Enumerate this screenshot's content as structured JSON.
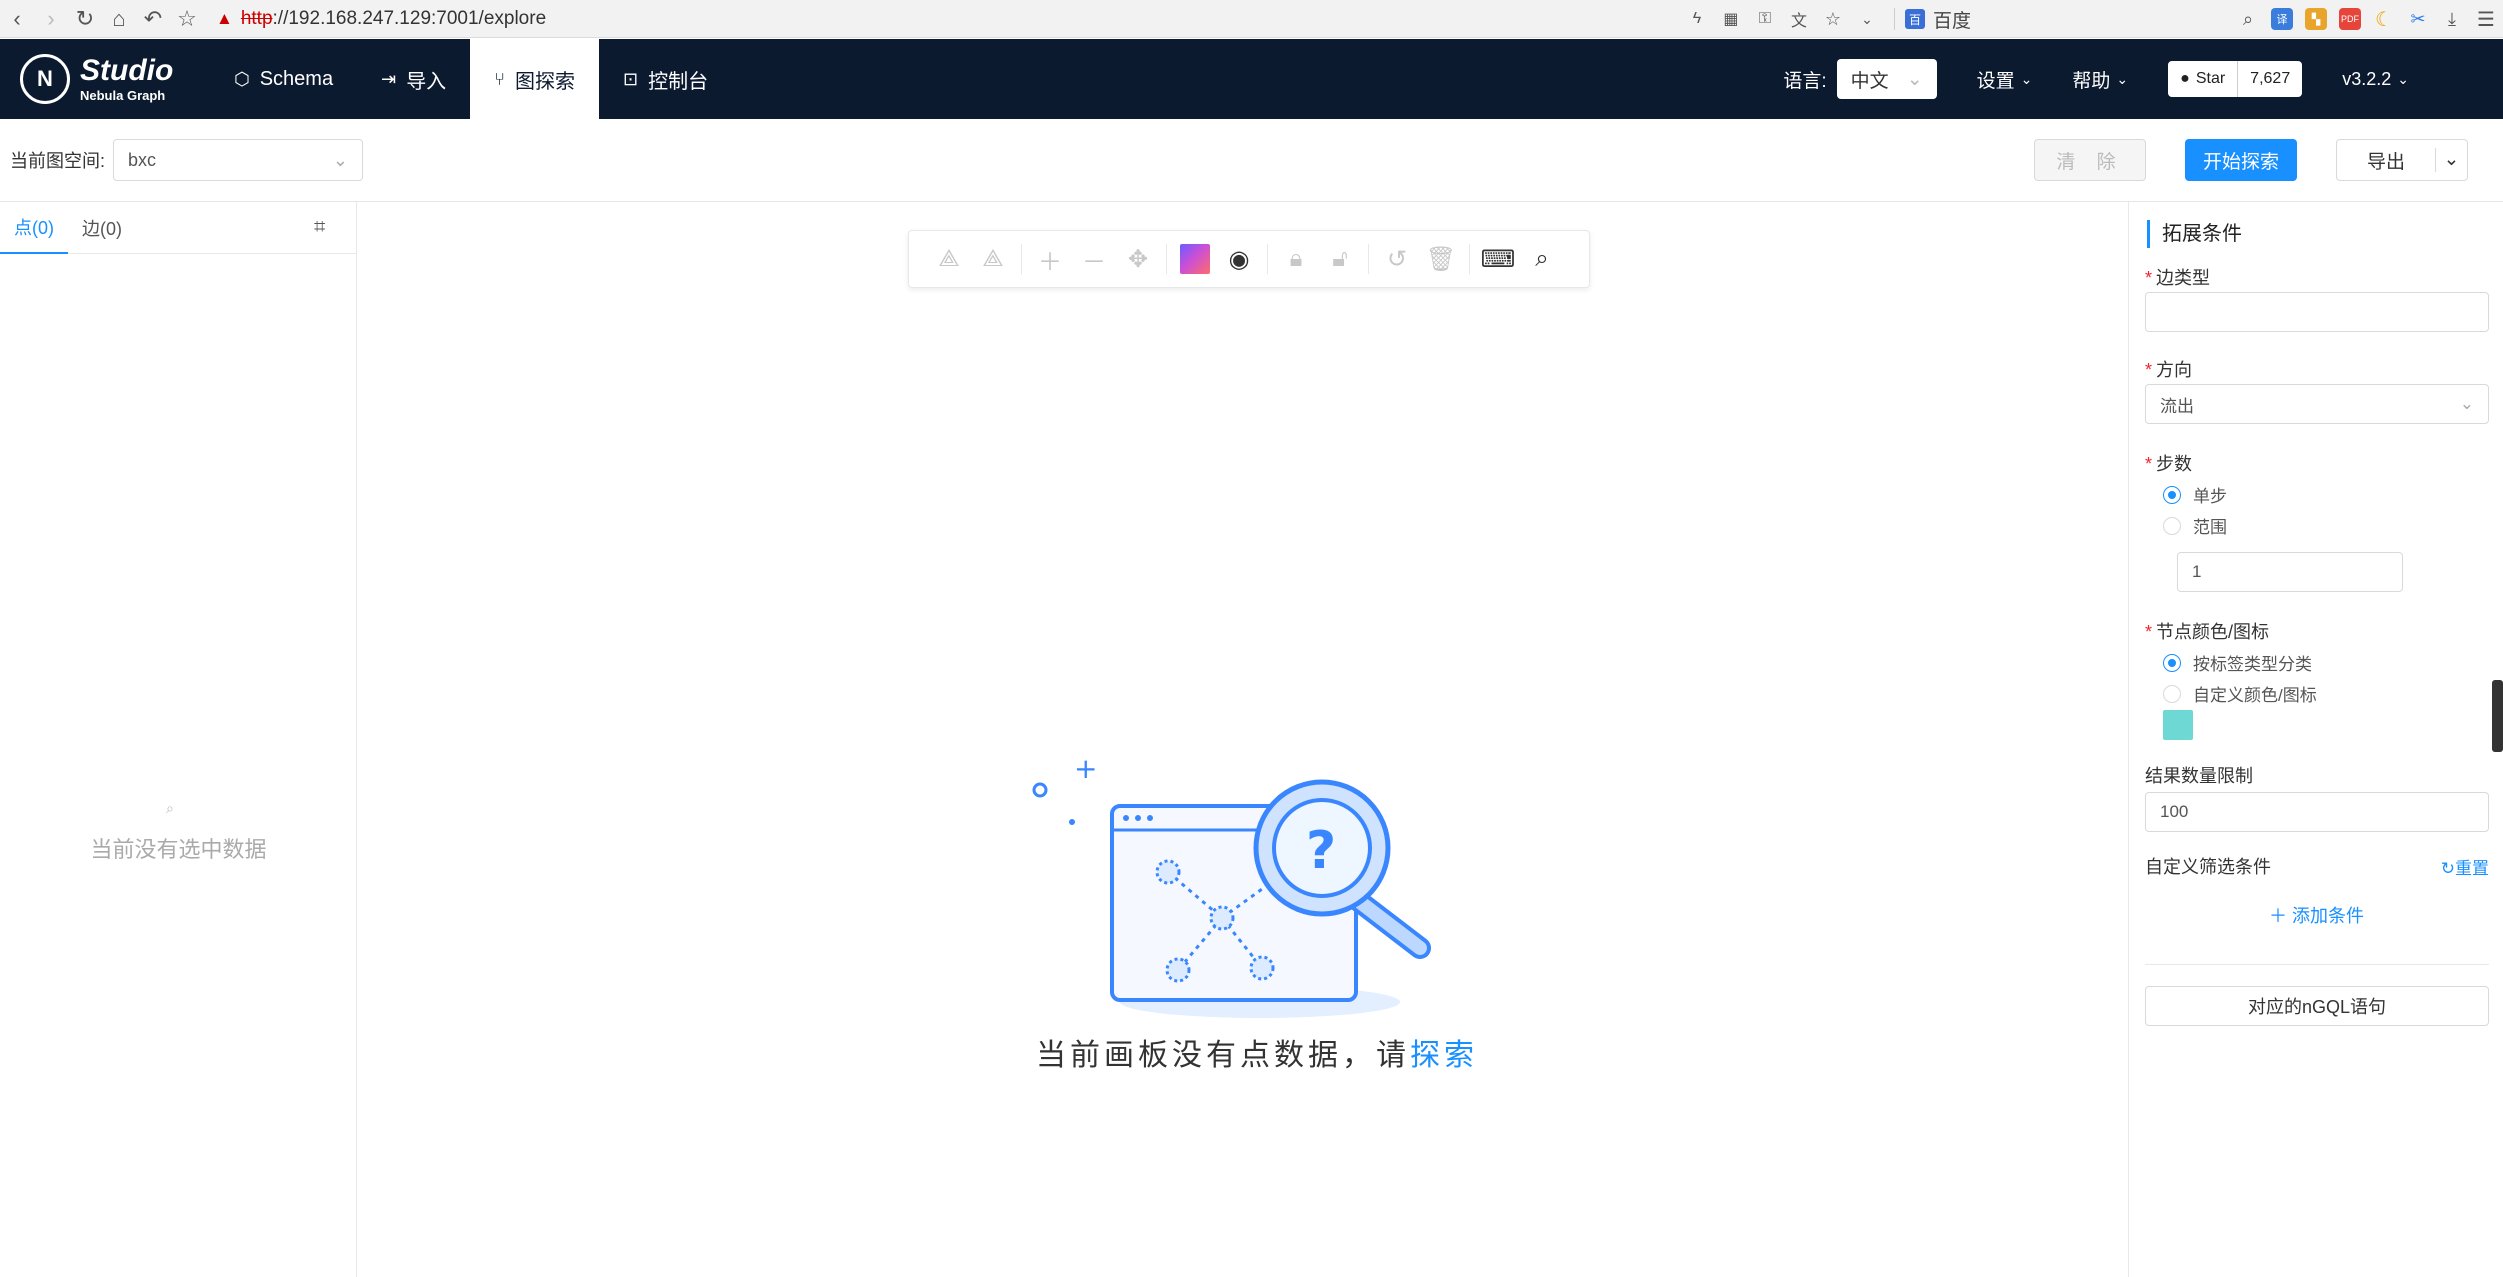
{
  "browser": {
    "url_scheme": "http",
    "url_rest": "://192.168.247.129:7001/explore",
    "search_engine": "百度"
  },
  "nav": {
    "logo_title": "Studio",
    "logo_subtitle": "Nebula Graph",
    "logo_mark": "N",
    "items": [
      {
        "label": "Schema",
        "icon": "schema-icon"
      },
      {
        "label": "导入",
        "icon": "import-icon"
      },
      {
        "label": "图探索",
        "icon": "explore-branch-icon",
        "active": true
      },
      {
        "label": "控制台",
        "icon": "console-icon"
      }
    ],
    "language_label": "语言:",
    "language_value": "中文",
    "settings": "设置",
    "help": "帮助",
    "github_star": "Star",
    "github_count": "7,627",
    "version": "v3.2.2"
  },
  "toolbar": {
    "space_label": "当前图空间:",
    "space_value": "bxc",
    "clear": "清 除",
    "explore": "开始探索",
    "export": "导出"
  },
  "left_panel": {
    "tab_nodes": "点(0)",
    "tab_edges": "边(0)",
    "empty": "当前没有选中数据"
  },
  "canvas": {
    "empty_text": "当前画板没有点数据，请",
    "empty_link": "探索"
  },
  "right_panel": {
    "title": "拓展条件",
    "edge_type_label": "边类型",
    "direction_label": "方向",
    "direction_value": "流出",
    "steps_label": "步数",
    "step_single": "单步",
    "step_range": "范围",
    "step_value": "1",
    "color_label": "节点颜色/图标",
    "color_by_tag": "按标签类型分类",
    "color_custom": "自定义颜色/图标",
    "swatch_color": "#6ed8d5",
    "limit_label": "结果数量限制",
    "limit_value": "100",
    "filter_label": "自定义筛选条件",
    "reset": "重置",
    "add_condition": "添加条件",
    "ngql_button": "对应的nGQL语句"
  },
  "colors": {
    "primary": "#1890ff",
    "nav_bg": "#0c1a2f"
  }
}
